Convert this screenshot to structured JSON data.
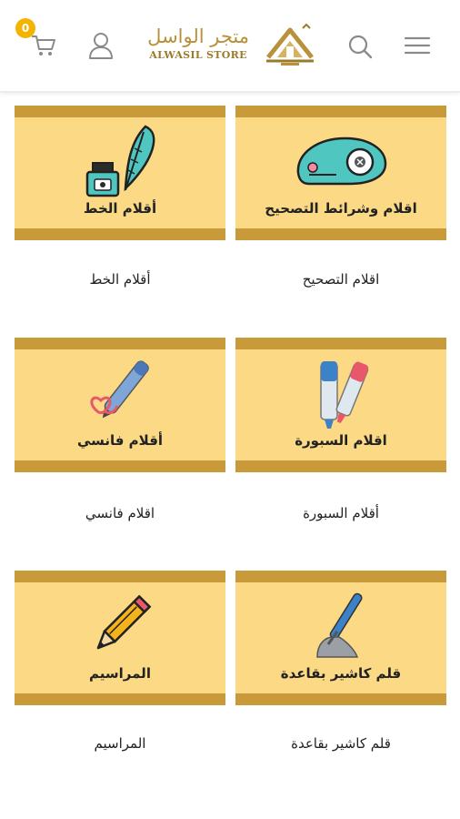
{
  "header": {
    "cart_count": "0",
    "logo_arabic": "متجر الواسل",
    "logo_english": "ALWASIL STORE",
    "icons": [
      "cart-icon",
      "user-icon",
      "store-logo-icon",
      "search-icon",
      "menu-icon"
    ]
  },
  "colors": {
    "tile_bg": "#fbd985",
    "tile_bar": "#c99a3a",
    "logo_gold": "#b8913a",
    "badge": "#f3b400"
  },
  "categories": [
    {
      "title": "اقلام وشرائط التصحيح",
      "caption": "اقلام التصحيح",
      "icon": "correction-tape-icon"
    },
    {
      "title": "أقلام الخط",
      "caption": "أقلام الخط",
      "icon": "ink-feather-icon"
    },
    {
      "title": "اقلام السبورة",
      "caption": "أقلام السبورة",
      "icon": "markers-icon"
    },
    {
      "title": "أقلام فانسي",
      "caption": "اقلام فانسي",
      "icon": "fancy-pen-icon"
    },
    {
      "title": "قلم كاشير بقاعدة",
      "caption": "قلم كاشير بقاعدة",
      "icon": "cashier-pen-icon"
    },
    {
      "title": "المراسيم",
      "caption": "المراسيم",
      "icon": "pencil-icon"
    }
  ]
}
